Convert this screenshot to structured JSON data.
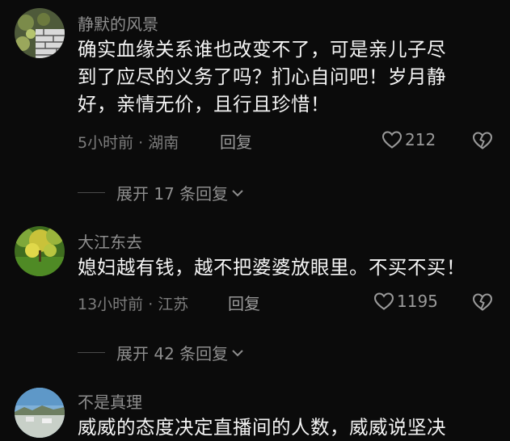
{
  "comments": [
    {
      "username": "静默的风景",
      "lines": [
        "确实血缘关系谁也改变不了，可是亲儿子尽",
        "到了应尽的义务了吗？扪心自问吧！岁月静",
        "好，亲情无价，且行且珍惜！"
      ],
      "meta": "5小时前 · 湖南",
      "reply_label": "回复",
      "likes": "212",
      "expand_label": "展开 17 条回复"
    },
    {
      "username": "大江东去",
      "lines": [
        "媳妇越有钱，越不把婆婆放眼里。不买不买！"
      ],
      "meta": "13小时前 · 江苏",
      "reply_label": "回复",
      "likes": "1195",
      "expand_label": "展开 42 条回复"
    },
    {
      "username": "不是真理",
      "lines": [
        "威威的态度决定直播间的人数，威威说坚决"
      ]
    }
  ],
  "colors": {
    "background": "#0b0b0b",
    "text_primary": "#f4f4f4",
    "text_secondary": "#8e8e8e"
  },
  "icons": [
    "heart-outline-icon",
    "broken-heart-icon",
    "chevron-down-icon"
  ]
}
